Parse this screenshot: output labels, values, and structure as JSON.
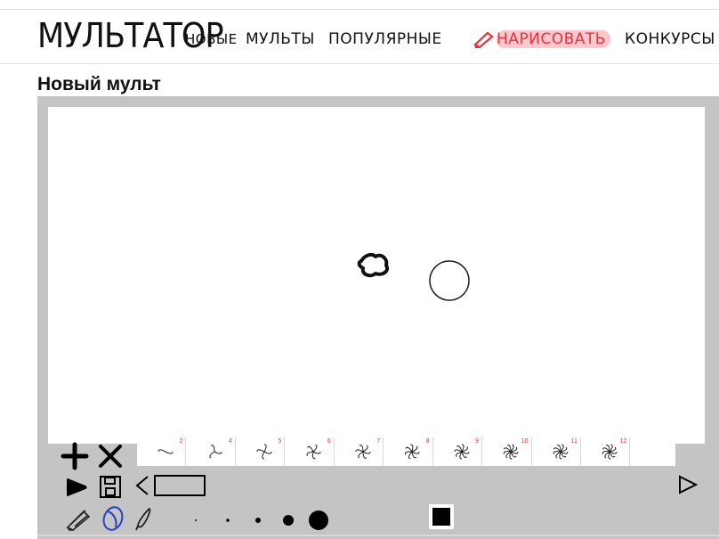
{
  "nav": {
    "logo": "МУЛЬТАТОР",
    "links": [
      "НОВЫЕ",
      "МУЛЬТЫ",
      "ПОПУЛЯРНЫЕ",
      "НАРИСОВАТЬ",
      "КОНКУРСЫ"
    ]
  },
  "page": {
    "title": "Новый мульт"
  },
  "editor": {
    "frames": [
      {
        "num": "2"
      },
      {
        "num": "4"
      },
      {
        "num": "5"
      },
      {
        "num": "6"
      },
      {
        "num": "7"
      },
      {
        "num": "8"
      },
      {
        "num": "9"
      },
      {
        "num": "10"
      },
      {
        "num": "11"
      },
      {
        "num": "12"
      }
    ],
    "brush_sizes": [
      "brush-size-1",
      "brush-size-2",
      "brush-size-3",
      "brush-size-4",
      "brush-size-5"
    ],
    "current_color": "#000000",
    "icons": [
      "plus-icon",
      "close-icon",
      "play-icon",
      "save-icon",
      "prev-frame-icon",
      "next-frame-icon",
      "pencil-icon",
      "eraser-icon",
      "brush-icon"
    ]
  },
  "colors": {
    "accent": "#e8323c",
    "toolbar_bg": "#c4c4c4",
    "canvas_bg": "#ffffff"
  }
}
